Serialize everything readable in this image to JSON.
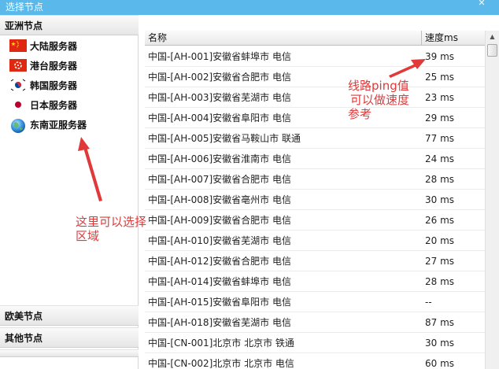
{
  "window": {
    "title": "选择节点",
    "close_glyph": "✕"
  },
  "sidebar": {
    "groups": [
      {
        "label": "亚洲节点"
      },
      {
        "label": "欧美节点"
      },
      {
        "label": "其他节点"
      }
    ],
    "regions": [
      {
        "label": "大陆服务器",
        "flag": "china-flag-icon"
      },
      {
        "label": "港台服务器",
        "flag": "hongkong-flag-icon"
      },
      {
        "label": "韩国服务器",
        "flag": "korea-flag-icon"
      },
      {
        "label": "日本服务器",
        "flag": "japan-flag-icon"
      },
      {
        "label": "东南亚服务器",
        "flag": "globe-icon"
      }
    ]
  },
  "table": {
    "columns": [
      "名称",
      "速度ms"
    ],
    "rows": [
      {
        "name": "中国-[AH-001]安徽省蚌埠市 电信",
        "speed": "39 ms"
      },
      {
        "name": "中国-[AH-002]安徽省合肥市 电信",
        "speed": "25 ms"
      },
      {
        "name": "中国-[AH-003]安徽省芜湖市 电信",
        "speed": "23 ms"
      },
      {
        "name": "中国-[AH-004]安徽省阜阳市 电信",
        "speed": "29 ms"
      },
      {
        "name": "中国-[AH-005]安徽省马鞍山市 联通",
        "speed": "77 ms"
      },
      {
        "name": "中国-[AH-006]安徽省淮南市 电信",
        "speed": "24 ms"
      },
      {
        "name": "中国-[AH-007]安徽省合肥市 电信",
        "speed": "28 ms"
      },
      {
        "name": "中国-[AH-008]安徽省亳州市 电信",
        "speed": "30 ms"
      },
      {
        "name": "中国-[AH-009]安徽省合肥市 电信",
        "speed": "26 ms"
      },
      {
        "name": "中国-[AH-010]安徽省芜湖市 电信",
        "speed": "20 ms"
      },
      {
        "name": "中国-[AH-012]安徽省合肥市 电信",
        "speed": "27 ms"
      },
      {
        "name": "中国-[AH-014]安徽省蚌埠市 电信",
        "speed": "28 ms"
      },
      {
        "name": "中国-[AH-015]安徽省阜阳市 电信",
        "speed": "--"
      },
      {
        "name": "中国-[AH-018]安徽省芜湖市 电信",
        "speed": "87 ms"
      },
      {
        "name": "中国-[CN-001]北京市 北京市 铁通",
        "speed": "30 ms"
      },
      {
        "name": "中国-[CN-002]北京市 北京市 电信",
        "speed": "60 ms"
      }
    ]
  },
  "annotations": {
    "ping_note_line1": "线路ping值",
    "ping_note_line2": "可以做速度",
    "ping_note_line3": "参考",
    "region_note_line1": "这里可以选择",
    "region_note_line2": "区域"
  },
  "colors": {
    "titlebar": "#5ab8ea",
    "annotation": "#e0393a"
  }
}
